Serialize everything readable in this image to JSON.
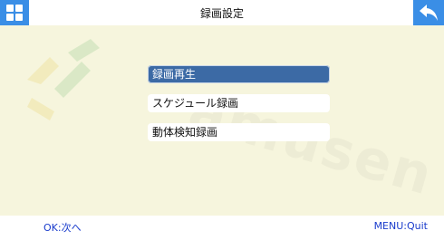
{
  "header": {
    "title": "録画設定",
    "home_icon": "grid-icon",
    "back_icon": "back-arrow-icon",
    "accent_color": "#3a8ee6"
  },
  "watermark": {
    "text": "amusen"
  },
  "menu": {
    "items": [
      {
        "label": "録画再生",
        "selected": true
      },
      {
        "label": "スケジュール録画",
        "selected": false
      },
      {
        "label": "動体検知録画",
        "selected": false
      }
    ],
    "selected_color": "#3c6aa5"
  },
  "footer": {
    "left_hint": "OK:次へ",
    "right_hint": "MENU:Quit",
    "hint_color": "#1a3ccc"
  }
}
